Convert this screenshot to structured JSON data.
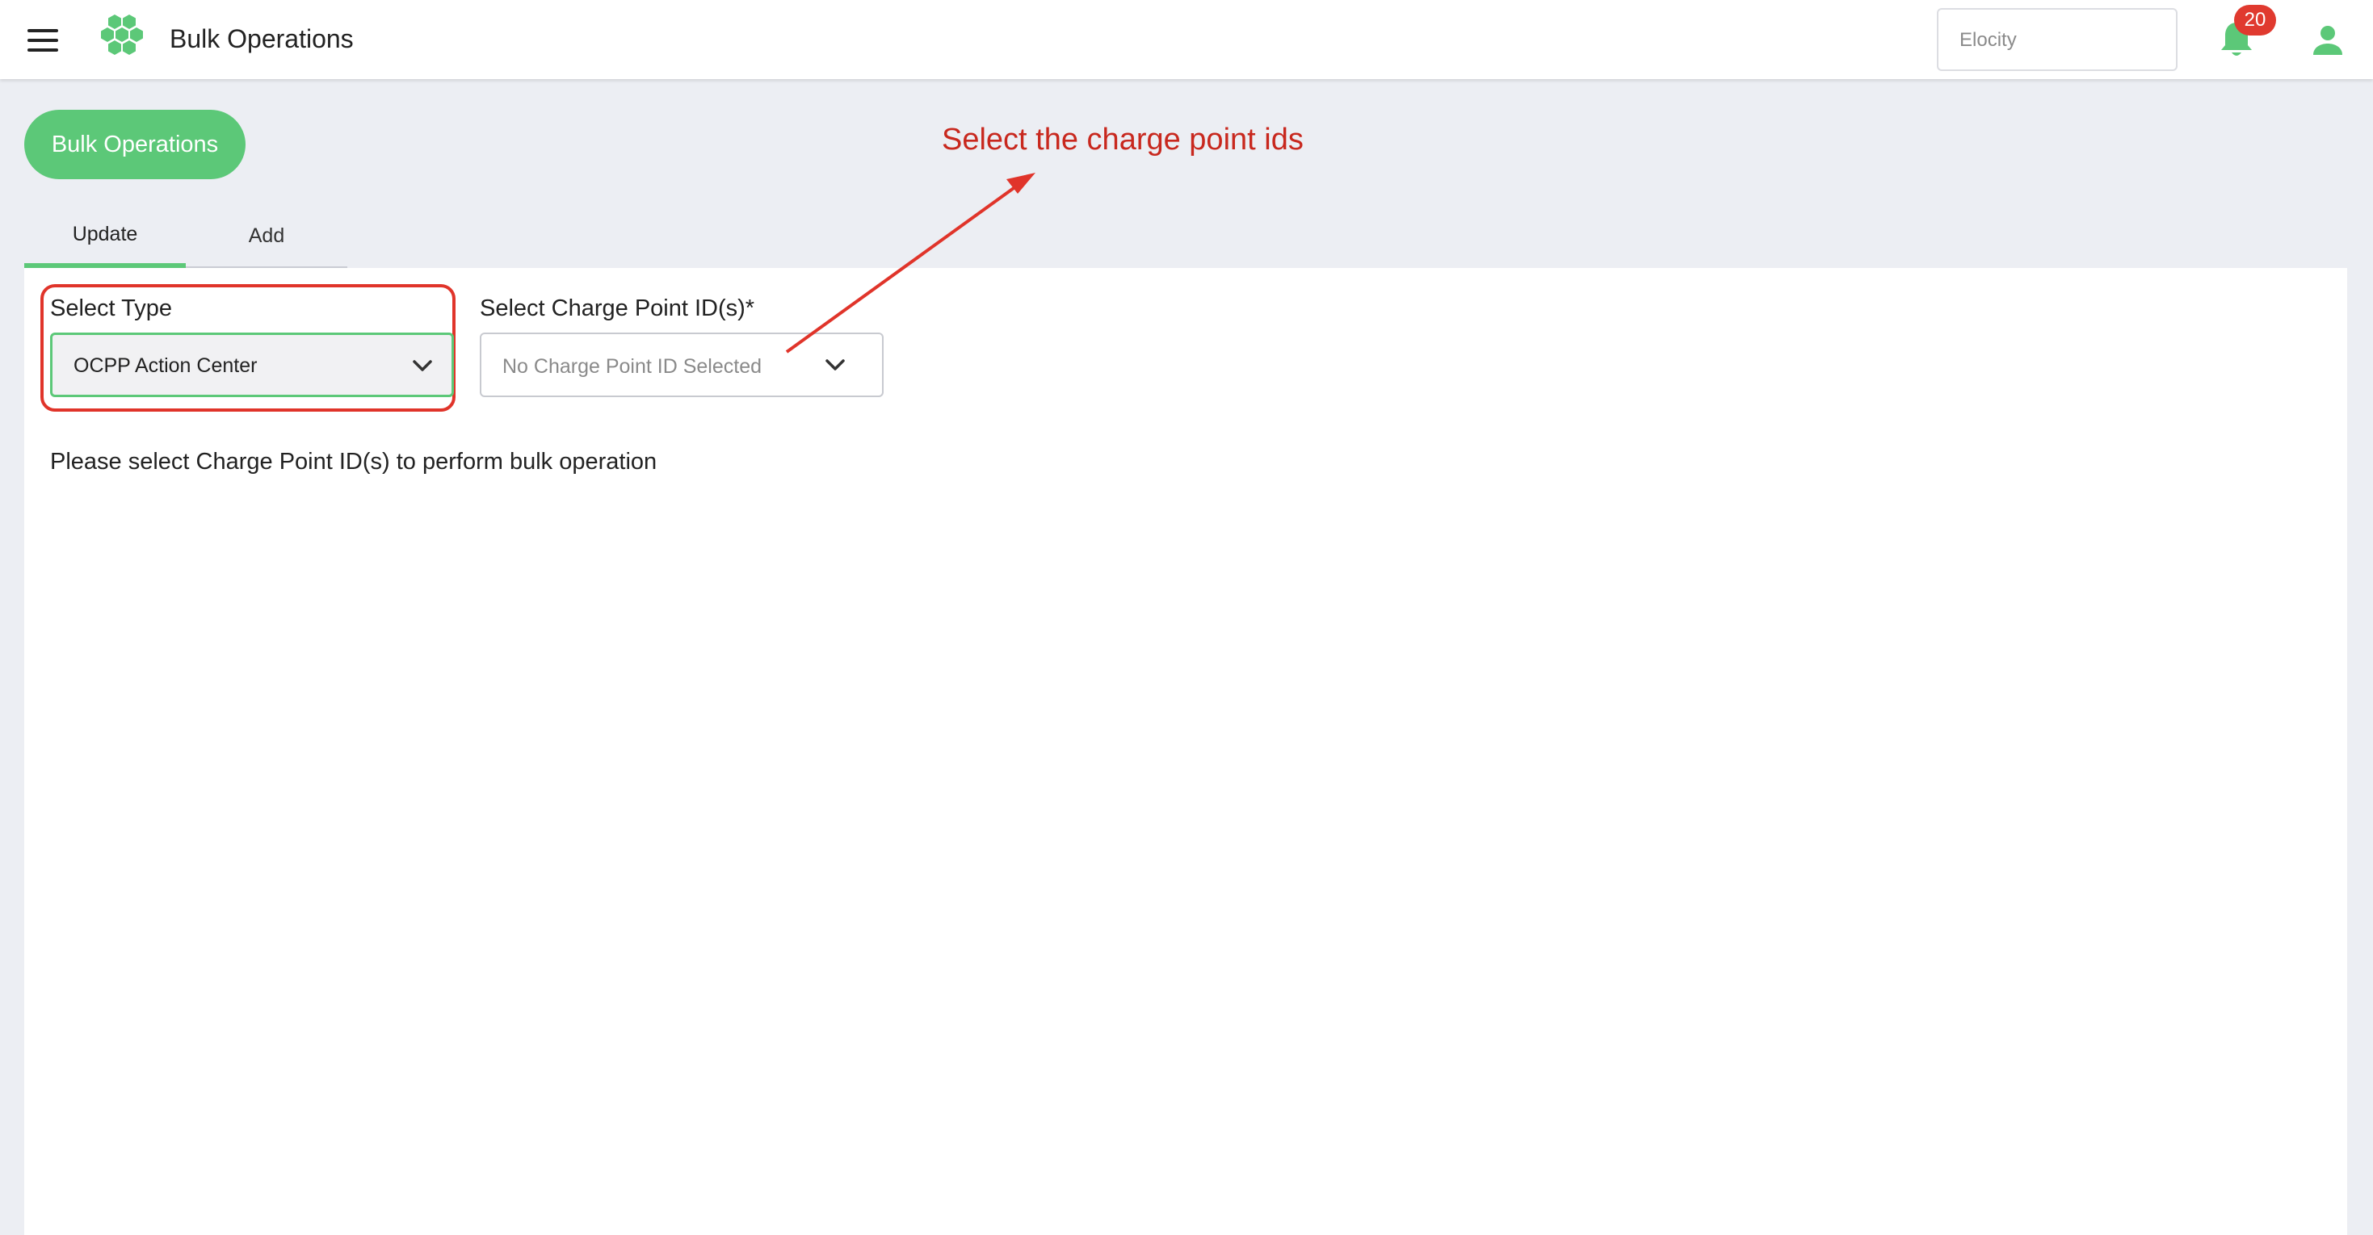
{
  "header": {
    "title": "Bulk Operations",
    "org_select": {
      "value": "Elocity"
    },
    "notifications_count": "20"
  },
  "page": {
    "pill_button_label": "Bulk Operations",
    "annotation": "Select the charge point ids",
    "tabs": [
      {
        "label": "Update",
        "active": true
      },
      {
        "label": "Add",
        "active": false
      }
    ]
  },
  "form": {
    "type_label": "Select Type",
    "type_value": "OCPP Action Center",
    "charge_point_label": "Select Charge Point ID(s)*",
    "charge_point_placeholder": "No Charge Point ID Selected",
    "info_message": "Please select Charge Point ID(s) to perform bulk operation"
  },
  "icons": {
    "menu": "menu-icon",
    "logo": "hexagon-cluster-logo-icon",
    "bell": "bell-icon",
    "user": "user-icon",
    "chevron": "chevron-down-icon"
  },
  "colors": {
    "brand_green": "#5cc878",
    "badge_red": "#e03a2f",
    "annotation_red": "#c8281e",
    "background": "#eceef3"
  }
}
